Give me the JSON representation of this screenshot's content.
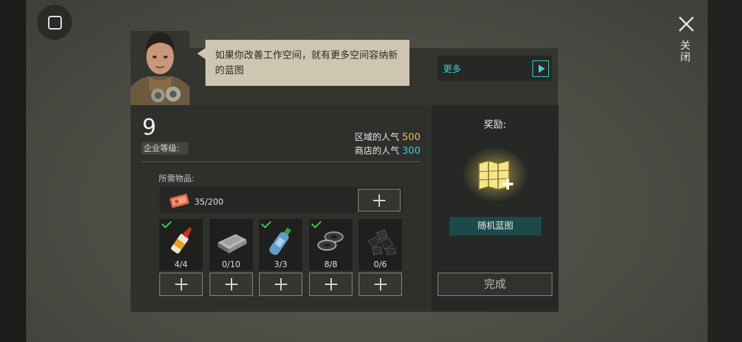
{
  "window": {
    "close_label": "关闭"
  },
  "character": {
    "dialogue": "如果你改善工作空间，就有更多空间容纳新的蓝图"
  },
  "more": {
    "label": "更多"
  },
  "level": {
    "value": "9",
    "label": "企业等级:"
  },
  "popularity": {
    "area_label": "区域的人气",
    "area_value": "500",
    "shop_label": "商店的人气",
    "shop_value": "300"
  },
  "requirements": {
    "label": "所需物品:",
    "currency": {
      "icon": "coupon-icon",
      "count": "35/200"
    },
    "items": [
      {
        "icon": "glue-icon",
        "count": "4/4",
        "complete": true
      },
      {
        "icon": "metal-ingot-icon",
        "count": "0/10",
        "complete": false
      },
      {
        "icon": "plastic-bottle-icon",
        "count": "3/3",
        "complete": true
      },
      {
        "icon": "washer-icon",
        "count": "8/8",
        "complete": true
      },
      {
        "icon": "coal-icon",
        "count": "0/6",
        "complete": false
      }
    ]
  },
  "reward": {
    "title": "奖励:",
    "icon": "blueprint-map-icon",
    "name": "随机蓝图"
  },
  "complete_button": {
    "label": "完成"
  },
  "colors": {
    "accent_cyan": "#3fd1d1",
    "accent_yellow": "#f2c230",
    "check_green": "#3ed34a",
    "reward_bg": "#1c4a4a"
  }
}
